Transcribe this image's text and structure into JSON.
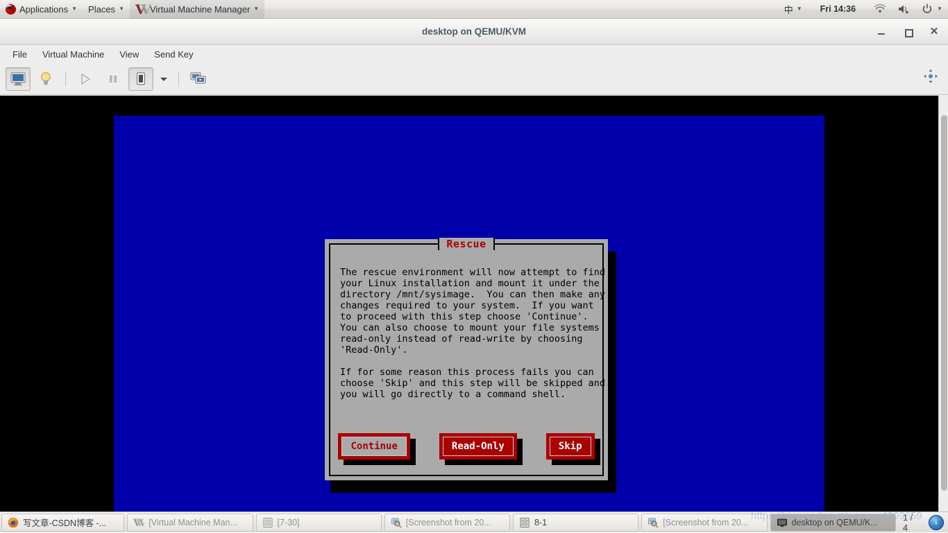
{
  "gnome_panel": {
    "items": [
      {
        "label": "Applications",
        "icon": "redhat-logo-icon",
        "has_caret": true
      },
      {
        "label": "Places",
        "icon": null,
        "has_caret": true
      },
      {
        "label": "Virtual Machine Manager",
        "icon": "vmm-logo-icon",
        "has_caret": true
      }
    ],
    "tray": {
      "input_method": "中",
      "input_caret": "▾",
      "clock": "Fri 14:36",
      "icons": [
        "wifi-icon",
        "volume-muted-icon",
        "power-icon"
      ],
      "power_caret": "▾"
    }
  },
  "window": {
    "title": "desktop on QEMU/KVM",
    "controls": {
      "minimize": "–",
      "maximize": "□",
      "close": "✕"
    }
  },
  "menubar": {
    "items": [
      "File",
      "Virtual Machine",
      "View",
      "Send Key"
    ]
  },
  "toolbar": {
    "buttons": [
      {
        "name": "show-console-button",
        "icon": "monitor-icon",
        "pressed": true
      },
      {
        "name": "show-details-button",
        "icon": "lightbulb-icon",
        "pressed": false
      },
      {
        "name": "run-button",
        "icon": "play-icon",
        "pressed": false,
        "disabled": true
      },
      {
        "name": "pause-button",
        "icon": "pause-icon",
        "pressed": false,
        "disabled": true
      },
      {
        "name": "shutdown-button",
        "icon": "shutdown-icon",
        "pressed": false
      },
      {
        "name": "shutdown-dropdown",
        "icon": "chevron-down-icon",
        "pressed": false
      },
      {
        "name": "fullscreen-button",
        "icon": "screens-icon",
        "pressed": false
      }
    ],
    "right_icon": "move-cursor-icon"
  },
  "vm_screen": {
    "background_color": "#0000aa",
    "dialog": {
      "title": "Rescue",
      "title_color": "#aa0000",
      "body": "The rescue environment will now attempt to find\nyour Linux installation and mount it under the\ndirectory /mnt/sysimage.  You can then make any\nchanges required to your system.  If you want\nto proceed with this step choose 'Continue'.\nYou can also choose to mount your file systems\nread-only instead of read-write by choosing\n'Read-Only'.\n\nIf for some reason this process fails you can\nchoose 'Skip' and this step will be skipped and\nyou will go directly to a command shell.",
      "buttons": [
        {
          "label": "Continue",
          "focused": true
        },
        {
          "label": "Read-Only",
          "focused": false
        },
        {
          "label": "Skip",
          "focused": false
        }
      ],
      "face_color": "#aa0000",
      "panel_color": "#aaaaaa"
    }
  },
  "taskbar": {
    "items": [
      {
        "label": "写文章-CSDN博客 -...",
        "icon": "firefox-icon",
        "dim": false
      },
      {
        "label": "[Virtual Machine Man...",
        "icon": "vmm-small-icon",
        "dim": true
      },
      {
        "label": "[7-30]",
        "icon": "archive-icon",
        "dim": true
      },
      {
        "label": "[Screenshot from 20...",
        "icon": "screenshot-icon",
        "dim": true
      },
      {
        "label": "8-1",
        "icon": "archive-icon",
        "dim": false
      },
      {
        "label": "[Screenshot from 20...",
        "icon": "screenshot-icon",
        "dim": true
      },
      {
        "label": "desktop on QEMU/K...",
        "icon": "monitor-small-icon",
        "dim": false
      }
    ],
    "workspace": "1 / 4",
    "tray_icon": "download-indicator-icon"
  },
  "watermark": {
    "text": "https://blog.csdn.net/weixin_4299659"
  }
}
